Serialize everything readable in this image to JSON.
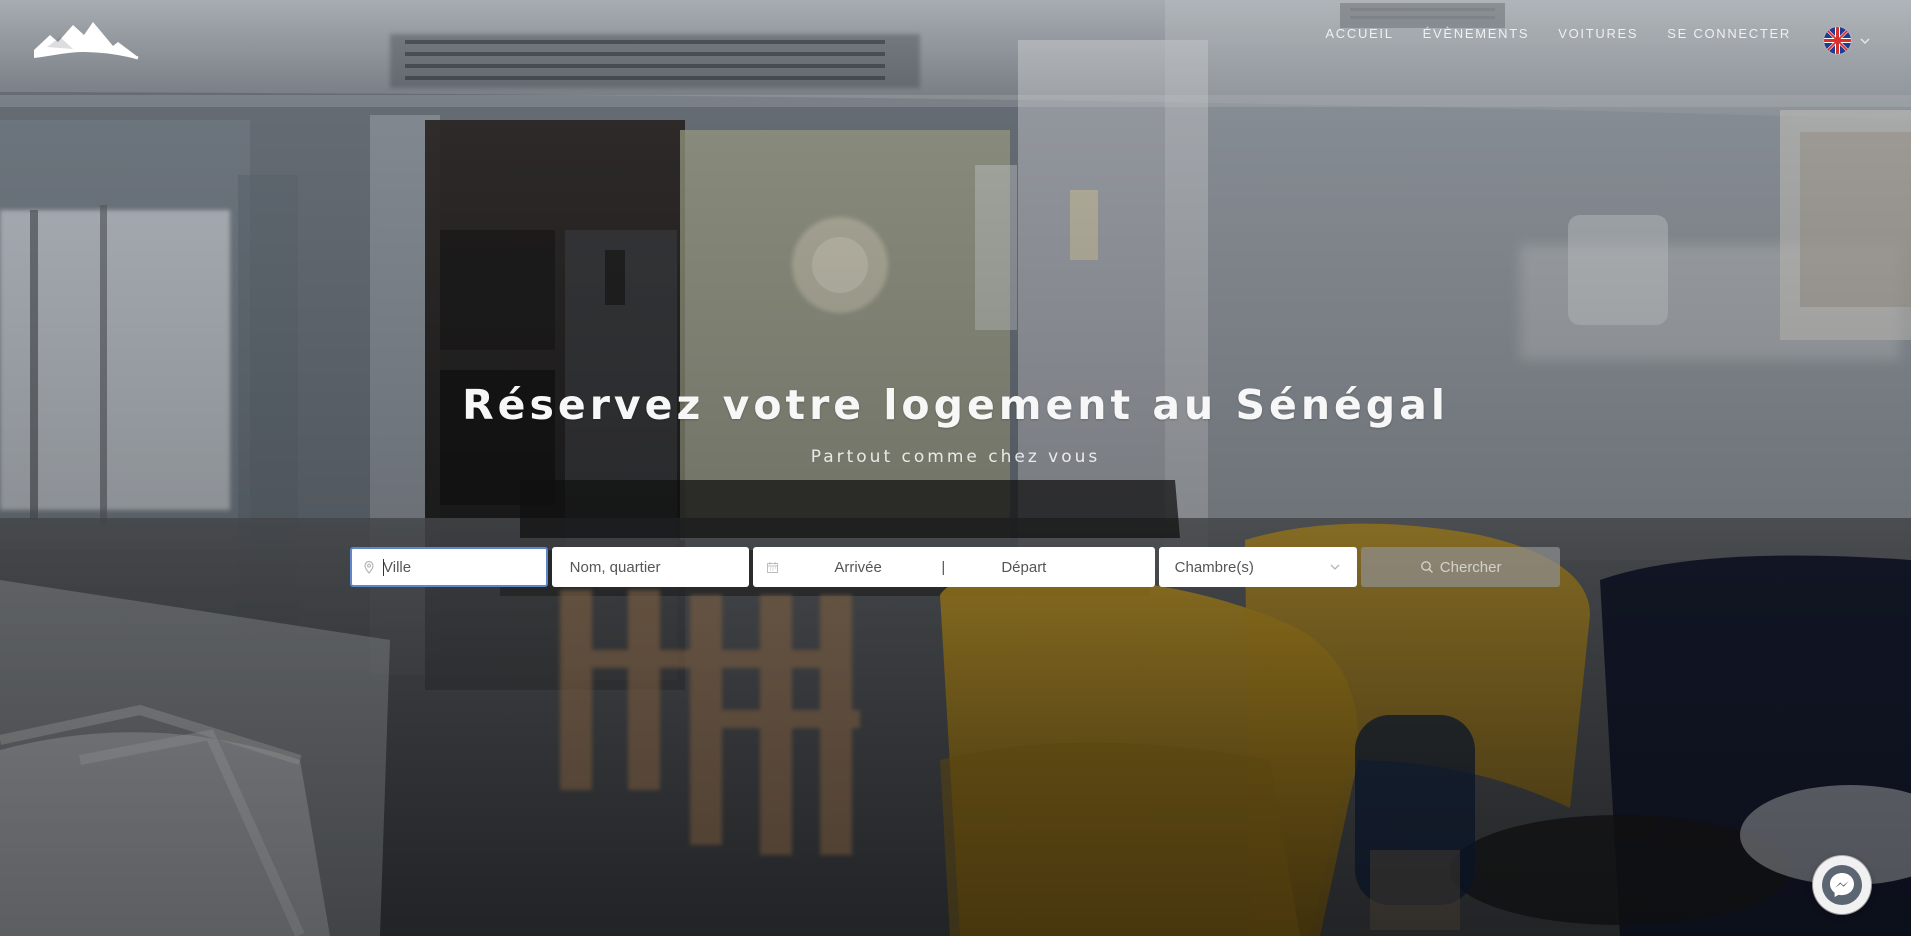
{
  "nav": {
    "items": [
      {
        "label": "ACCUEIL"
      },
      {
        "label": "ÉVÈNEMENTS"
      },
      {
        "label": "VOITURES"
      },
      {
        "label": "SE CONNECTER"
      }
    ],
    "language": {
      "flag": "uk-flag-icon"
    }
  },
  "hero": {
    "title": "Réservez votre logement au Sénégal",
    "subtitle": "Partout comme chez vous"
  },
  "search": {
    "city": {
      "placeholder": "Ville",
      "value": ""
    },
    "area": {
      "placeholder": "Nom, quartier",
      "value": ""
    },
    "dates": {
      "arrival": "Arrivée",
      "separator": "|",
      "departure": "Départ"
    },
    "rooms": {
      "selected": "Chambre(s)"
    },
    "button": {
      "label": "Chercher"
    }
  },
  "icons": {
    "logo": "mountain-logo-icon",
    "location": "location-pin-icon",
    "calendar": "calendar-icon",
    "chevron": "chevron-down-icon",
    "search": "search-icon",
    "chat": "messenger-icon"
  },
  "colors": {
    "focus_border": "#5e86c8",
    "search_button": "#8f8f8f",
    "text": "#555555",
    "hero_text": "#f7f7f7"
  }
}
